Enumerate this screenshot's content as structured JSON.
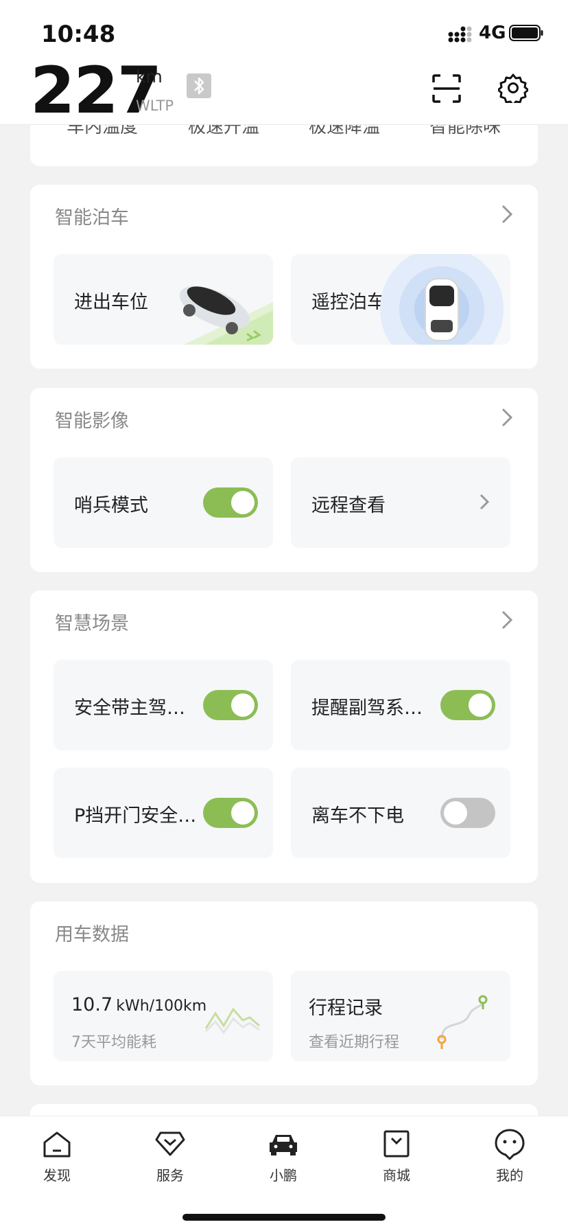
{
  "status": {
    "time": "10:48",
    "network": "4G"
  },
  "header": {
    "range": "227",
    "unit": "km",
    "standard": "WLTP"
  },
  "climate_peek": {
    "items": [
      "车内温度",
      "极速升温",
      "极速降温",
      "智能除味"
    ]
  },
  "parking": {
    "title": "智能泊车",
    "tiles": [
      {
        "label": "进出车位"
      },
      {
        "label": "遥控泊车"
      }
    ]
  },
  "imaging": {
    "title": "智能影像",
    "sentry": {
      "label": "哨兵模式",
      "on": true
    },
    "remote_view": {
      "label": "远程查看"
    }
  },
  "scenes": {
    "title": "智慧场景",
    "items": [
      {
        "label": "安全带主驾…",
        "on": true
      },
      {
        "label": "提醒副驾系…",
        "on": true
      },
      {
        "label": "P挡开门安全…",
        "on": true
      },
      {
        "label": "离车不下电",
        "on": false
      }
    ]
  },
  "usage": {
    "title": "用车数据",
    "energy": {
      "value": "10.7",
      "unit": "kWh/100km",
      "label": "7天平均能耗"
    },
    "trips": {
      "title": "行程记录",
      "subtitle": "查看近期行程"
    }
  },
  "nav": {
    "items": [
      {
        "label": "发现",
        "icon": "home-icon"
      },
      {
        "label": "服务",
        "icon": "service-icon"
      },
      {
        "label": "小鹏",
        "icon": "car-icon"
      },
      {
        "label": "商城",
        "icon": "shop-icon"
      },
      {
        "label": "我的",
        "icon": "profile-icon"
      }
    ]
  },
  "colors": {
    "accent_green": "#8cbd55",
    "toggle_off": "#c4c4c4",
    "background": "#f2f2f2"
  }
}
